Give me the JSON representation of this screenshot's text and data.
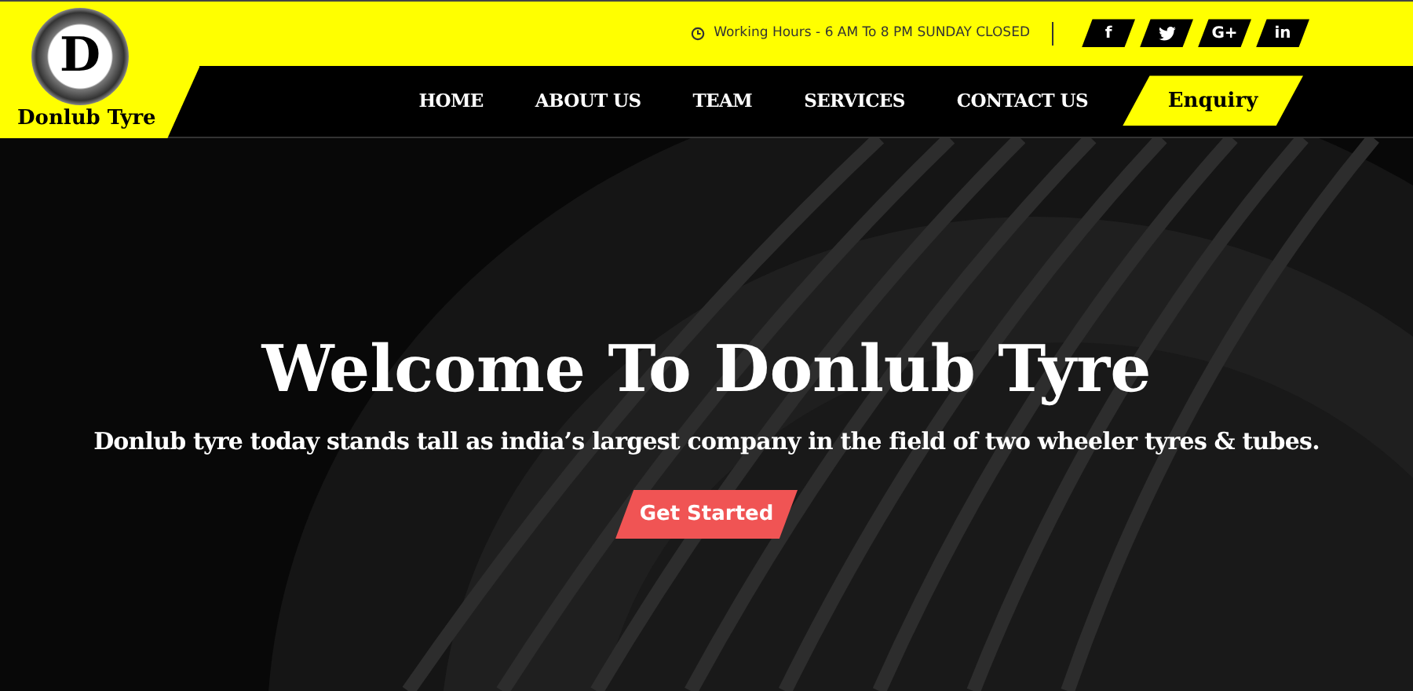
{
  "brand": {
    "name": "Donlub Tyre",
    "mark": "D"
  },
  "topbar": {
    "hours": "Working Hours - 6 AM To 8 PM SUNDAY CLOSED",
    "social": [
      {
        "kind": "text",
        "label": "f"
      },
      {
        "kind": "bird"
      },
      {
        "kind": "text",
        "label": "G+"
      },
      {
        "kind": "text",
        "label": "in"
      }
    ]
  },
  "nav": {
    "items": [
      "HOME",
      "ABOUT US",
      "TEAM",
      "SERVICES",
      "CONTACT US"
    ],
    "cta": "Enquiry"
  },
  "hero": {
    "kind": "picture",
    "title": "Welcome To Donlub Tyre",
    "subtitle": "Donlub tyre today stands tall as india’s largest company in the field of two wheeler tyres & tubes.",
    "button": "Get Started"
  }
}
